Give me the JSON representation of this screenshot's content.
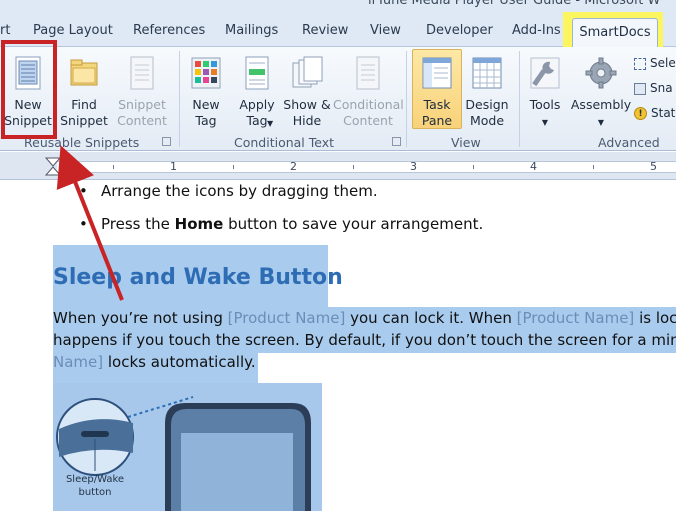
{
  "window": {
    "title_partial": "irTune Media Player User Guide - Microsoft W"
  },
  "tabs": [
    {
      "label": "rt"
    },
    {
      "label": "Page Layout"
    },
    {
      "label": "References"
    },
    {
      "label": "Mailings"
    },
    {
      "label": "Review"
    },
    {
      "label": "View"
    },
    {
      "label": "Developer"
    },
    {
      "label": "Add-Ins"
    },
    {
      "label": "SmartDocs"
    }
  ],
  "ribbon": {
    "buttons": {
      "new_snippet": [
        "New",
        "Snippet"
      ],
      "find_snippet": [
        "Find",
        "Snippet"
      ],
      "snippet_content": [
        "Snippet",
        "Content"
      ],
      "new_tag": [
        "New",
        "Tag"
      ],
      "apply_tag": [
        "Apply",
        "Tag"
      ],
      "show_hide": [
        "Show &",
        "Hide"
      ],
      "conditional_content": [
        "Conditional",
        "Content"
      ],
      "task_pane": [
        "Task",
        "Pane"
      ],
      "design_mode": [
        "Design",
        "Mode"
      ],
      "tools": [
        "Tools"
      ],
      "assembly": [
        "Assembly"
      ]
    },
    "small_buttons": [
      "Sele",
      "Sna",
      "Stat"
    ],
    "groups": [
      "Reusable Snippets",
      "Conditional Text",
      "View",
      "Advanced"
    ]
  },
  "ruler": {
    "numbers": [
      "1",
      "2",
      "3",
      "4",
      "5"
    ]
  },
  "document": {
    "bullet1": "Arrange the icons by dragging them.",
    "bullet2_pre": "Press the ",
    "bullet2_bold": "Home",
    "bullet2_post": " button to save your arrangement.",
    "heading": "Sleep and Wake Button",
    "p1_a": "When you’re not using ",
    "p1_ph1": "[Product Name]",
    "p1_b": " you can lock it.  When ",
    "p1_ph2": "[Product Name]",
    "p1_c": " is loc",
    "p2": "happens if you touch the screen.  By default, if you don’t touch the screen for a minu",
    "p3_ph": "Name]",
    "p3_b": " locks automatically.",
    "image_caption": "Sleep/Wake button"
  },
  "colors": {
    "annotation_red": "#c82425",
    "highlight_yellow": "#fbf560",
    "selection_blue": "#a8cbee",
    "heading_blue": "#2e6db4"
  }
}
